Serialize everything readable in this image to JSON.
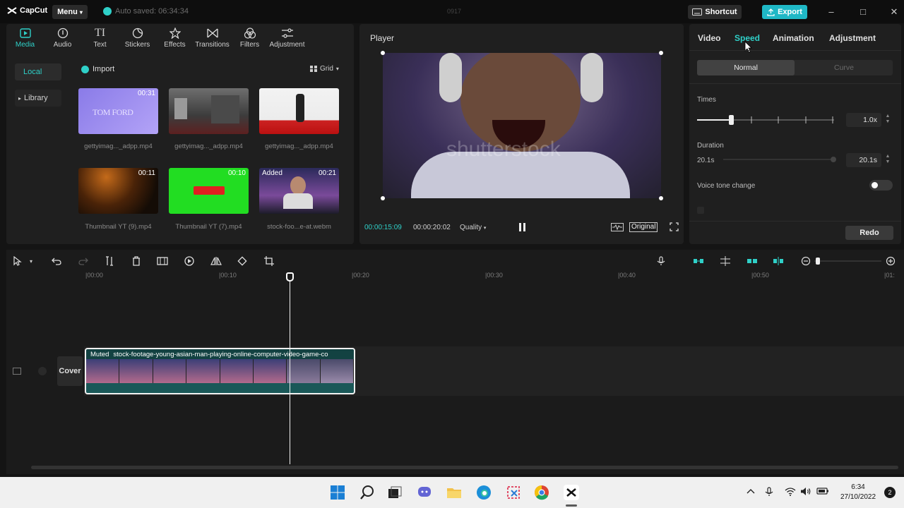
{
  "titlebar": {
    "logo": "CapCut",
    "menu_label": "Menu",
    "autosave_text": "Auto saved: 06:34:34",
    "center_text": "0917",
    "shortcut_label": "Shortcut",
    "export_label": "Export"
  },
  "media": {
    "tools": [
      {
        "label": "Media",
        "icon": "media-icon"
      },
      {
        "label": "Audio",
        "icon": "audio-icon"
      },
      {
        "label": "Text",
        "icon": "text-icon"
      },
      {
        "label": "Stickers",
        "icon": "stickers-icon"
      },
      {
        "label": "Effects",
        "icon": "effects-icon"
      },
      {
        "label": "Transitions",
        "icon": "transitions-icon"
      },
      {
        "label": "Filters",
        "icon": "filters-icon"
      },
      {
        "label": "Adjustment",
        "icon": "adjustment-icon"
      }
    ],
    "side_local": "Local",
    "side_library": "Library",
    "import_label": "Import",
    "view_label": "Grid",
    "items": [
      {
        "name": "gettyimag..._adpp.mp4",
        "duration": "00:31",
        "badge": ""
      },
      {
        "name": "gettyimag..._adpp.mp4",
        "duration": "",
        "badge": ""
      },
      {
        "name": "gettyimag..._adpp.mp4",
        "duration": "",
        "badge": ""
      },
      {
        "name": "Thumbnail YT (9).mp4",
        "duration": "00:11",
        "badge": ""
      },
      {
        "name": "Thumbnail YT (7).mp4",
        "duration": "00:10",
        "badge": ""
      },
      {
        "name": "stock-foo...e-at.webm",
        "duration": "00:21",
        "badge": "Added"
      }
    ],
    "thumb_text_1": "TOM FORD"
  },
  "player": {
    "title": "Player",
    "watermark": "shutterstock",
    "current_time": "00:00:15:09",
    "total_time": "00:00:20:02",
    "quality_label": "Quality",
    "ratio_label": "Original"
  },
  "props": {
    "tabs": [
      "Video",
      "Speed",
      "Animation",
      "Adjustment"
    ],
    "active_tab": "Speed",
    "mode_normal": "Normal",
    "mode_curve": "Curve",
    "times_label": "Times",
    "times_value": "1.0x",
    "times_level": 0.25,
    "duration_label": "Duration",
    "duration_min": "20.1s",
    "duration_value": "20.1s",
    "voice_label": "Voice tone change",
    "voice_on": false,
    "redo_label": "Redo"
  },
  "timeline": {
    "ruler": [
      "00:00",
      "00:10",
      "00:20",
      "00:30",
      "00:40",
      "00:50",
      "01:"
    ],
    "clip_muted": "Muted",
    "clip_name": "stock-footage-young-asian-man-playing-online-computer-video-game-co",
    "cover_label": "Cover"
  },
  "taskbar": {
    "time": "6:34",
    "date": "27/10/2022",
    "notifications": "2"
  }
}
